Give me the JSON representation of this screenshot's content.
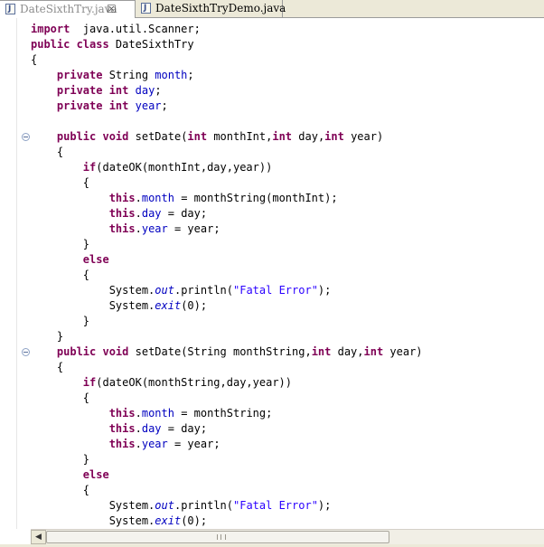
{
  "tabs": [
    {
      "label": "DateSixthTry.java",
      "active": true,
      "close": "☒"
    },
    {
      "label": "DateSixthTryDemo.java",
      "active": false
    }
  ],
  "colors": {
    "keyword": "#7f0055",
    "field": "#0000c0",
    "string": "#2a00ff"
  },
  "code_lines": [
    [
      [
        "kw",
        "import"
      ],
      [
        "",
        "  java.util.Scanner;"
      ]
    ],
    [
      [
        "kw",
        "public class"
      ],
      [
        "",
        " DateSixthTry"
      ]
    ],
    [
      [
        "",
        "{"
      ]
    ],
    [
      [
        "",
        "    "
      ],
      [
        "kw",
        "private"
      ],
      [
        "",
        " String "
      ],
      [
        "fld",
        "month"
      ],
      [
        "",
        ";"
      ]
    ],
    [
      [
        "",
        "    "
      ],
      [
        "kw",
        "private int"
      ],
      [
        "",
        " "
      ],
      [
        "fld",
        "day"
      ],
      [
        "",
        ";"
      ]
    ],
    [
      [
        "",
        "    "
      ],
      [
        "kw",
        "private int"
      ],
      [
        "",
        " "
      ],
      [
        "fld",
        "year"
      ],
      [
        "",
        ";"
      ]
    ],
    [
      [
        "",
        ""
      ]
    ],
    [
      [
        "",
        "    "
      ],
      [
        "kw",
        "public void"
      ],
      [
        "",
        " setDate("
      ],
      [
        "kw",
        "int"
      ],
      [
        "",
        " monthInt,"
      ],
      [
        "kw",
        "int"
      ],
      [
        "",
        " day,"
      ],
      [
        "kw",
        "int"
      ],
      [
        "",
        " year)"
      ]
    ],
    [
      [
        "",
        "    {"
      ]
    ],
    [
      [
        "",
        "        "
      ],
      [
        "kw",
        "if"
      ],
      [
        "",
        "(dateOK(monthInt,day,year))"
      ]
    ],
    [
      [
        "",
        "        {"
      ]
    ],
    [
      [
        "",
        "            "
      ],
      [
        "kw",
        "this"
      ],
      [
        "",
        "."
      ],
      [
        "fld",
        "month"
      ],
      [
        "",
        " = monthString(monthInt);"
      ]
    ],
    [
      [
        "",
        "            "
      ],
      [
        "kw",
        "this"
      ],
      [
        "",
        "."
      ],
      [
        "fld",
        "day"
      ],
      [
        "",
        " = day;"
      ]
    ],
    [
      [
        "",
        "            "
      ],
      [
        "kw",
        "this"
      ],
      [
        "",
        "."
      ],
      [
        "fld",
        "year"
      ],
      [
        "",
        " = year;"
      ]
    ],
    [
      [
        "",
        "        }"
      ]
    ],
    [
      [
        "",
        "        "
      ],
      [
        "kw",
        "else"
      ]
    ],
    [
      [
        "",
        "        {"
      ]
    ],
    [
      [
        "",
        "            System."
      ],
      [
        "st",
        "out"
      ],
      [
        "",
        ".println("
      ],
      [
        "str",
        "\"Fatal Error\""
      ],
      [
        "",
        ");"
      ]
    ],
    [
      [
        "",
        "            System."
      ],
      [
        "st",
        "exit"
      ],
      [
        "",
        "(0);"
      ]
    ],
    [
      [
        "",
        "        }"
      ]
    ],
    [
      [
        "",
        "    }"
      ]
    ],
    [
      [
        "",
        "    "
      ],
      [
        "kw",
        "public void"
      ],
      [
        "",
        " setDate(String monthString,"
      ],
      [
        "kw",
        "int"
      ],
      [
        "",
        " day,"
      ],
      [
        "kw",
        "int"
      ],
      [
        "",
        " year)"
      ]
    ],
    [
      [
        "",
        "    {"
      ]
    ],
    [
      [
        "",
        "        "
      ],
      [
        "kw",
        "if"
      ],
      [
        "",
        "(dateOK(monthString,day,year))"
      ]
    ],
    [
      [
        "",
        "        {"
      ]
    ],
    [
      [
        "",
        "            "
      ],
      [
        "kw",
        "this"
      ],
      [
        "",
        "."
      ],
      [
        "fld",
        "month"
      ],
      [
        "",
        " = monthString;"
      ]
    ],
    [
      [
        "",
        "            "
      ],
      [
        "kw",
        "this"
      ],
      [
        "",
        "."
      ],
      [
        "fld",
        "day"
      ],
      [
        "",
        " = day;"
      ]
    ],
    [
      [
        "",
        "            "
      ],
      [
        "kw",
        "this"
      ],
      [
        "",
        "."
      ],
      [
        "fld",
        "year"
      ],
      [
        "",
        " = year;"
      ]
    ],
    [
      [
        "",
        "        }"
      ]
    ],
    [
      [
        "",
        "        "
      ],
      [
        "kw",
        "else"
      ]
    ],
    [
      [
        "",
        "        {"
      ]
    ],
    [
      [
        "",
        "            System."
      ],
      [
        "st",
        "out"
      ],
      [
        "",
        ".println("
      ],
      [
        "str",
        "\"Fatal Error\""
      ],
      [
        "",
        ");"
      ]
    ],
    [
      [
        "",
        "            System."
      ],
      [
        "st",
        "exit"
      ],
      [
        "",
        "(0);"
      ]
    ]
  ],
  "fold_markers_lines": [
    7,
    21
  ],
  "scrollbar": {
    "left_arrow": "◀"
  }
}
